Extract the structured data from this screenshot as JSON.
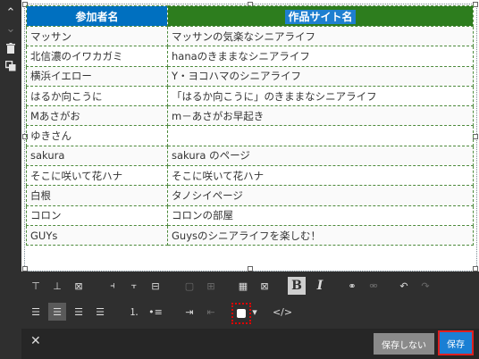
{
  "table": {
    "headers": [
      "参加者名",
      "作品サイト名"
    ],
    "rows": [
      [
        "マッサン",
        "マッサンの気楽なシニアライフ"
      ],
      [
        "北信濃のイワカガミ",
        "hanaのきままなシニアライフ"
      ],
      [
        "横浜イエロー",
        "Y・ヨコハマのシニアライフ"
      ],
      [
        "はるか向こうに",
        "「はるか向こうに」のきままなシニアライフ"
      ],
      [
        "Mあさがお",
        "m－あさがお早起き"
      ],
      [
        "ゆきさん",
        ""
      ],
      [
        "sakura",
        "sakura のページ"
      ],
      [
        "そこに咲いて花ハナ",
        "そこに咲いて花ハナ"
      ],
      [
        "白根",
        "タノシイページ"
      ],
      [
        "コロン",
        "コロンの部屋"
      ],
      [
        "GUYs",
        "Guysのシニアライフを楽しむ！"
      ]
    ]
  },
  "footer": {
    "close_label": "✕",
    "cancel_label": "保存しない",
    "save_label": "保存"
  },
  "toolbar": {
    "bold_label": "B",
    "italic_label": "I",
    "source_label": "</>"
  },
  "colors": {
    "header_blue": "#0070c0",
    "header_green": "#2d7d1e",
    "save_button": "#1a7fd4",
    "highlight_outline": "#e02020"
  }
}
